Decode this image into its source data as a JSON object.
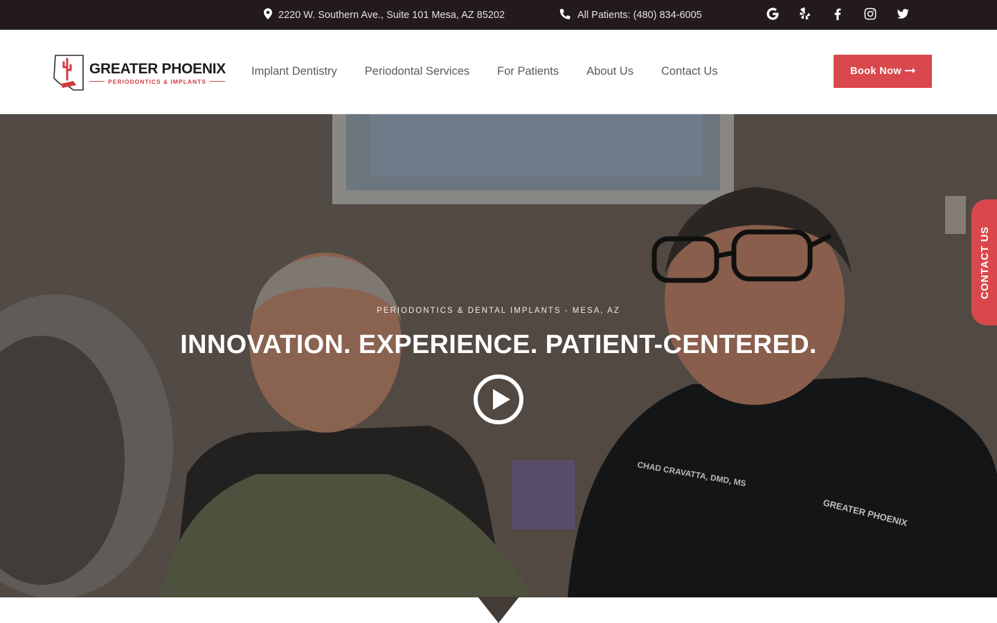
{
  "topbar": {
    "address": "2220 W. Southern Ave., Suite 101 Mesa, AZ 85202",
    "phone": "All Patients: (480) 834-6005",
    "icons": [
      "map-pin-icon",
      "phone-icon"
    ],
    "socials": [
      {
        "name": "google-icon"
      },
      {
        "name": "yelp-icon"
      },
      {
        "name": "facebook-icon"
      },
      {
        "name": "instagram-icon"
      },
      {
        "name": "twitter-icon"
      }
    ]
  },
  "header": {
    "logo_name": "GREATER PHOENIX",
    "logo_sub": "PERIODONTICS & IMPLANTS",
    "nav": [
      "Implant Dentistry",
      "Periodontal Services",
      "For Patients",
      "About Us",
      "Contact Us"
    ],
    "book_label": "Book Now"
  },
  "hero": {
    "eyebrow": "PERIODONTICS & DENTAL IMPLANTS - MESA, AZ",
    "headline": "INNOVATION. EXPERIENCE. PATIENT-CENTERED.",
    "scrub_name": "CHAD CRAVATTA, DMD, MS",
    "scrub_logo": "GREATER PHOENIX"
  },
  "side_tab": {
    "label": "CONTACT US"
  },
  "colors": {
    "topbar_bg": "#231b1b",
    "accent": "#d9484c",
    "nav_text": "#5a5a5a",
    "logo_text": "#1d1d1d"
  }
}
